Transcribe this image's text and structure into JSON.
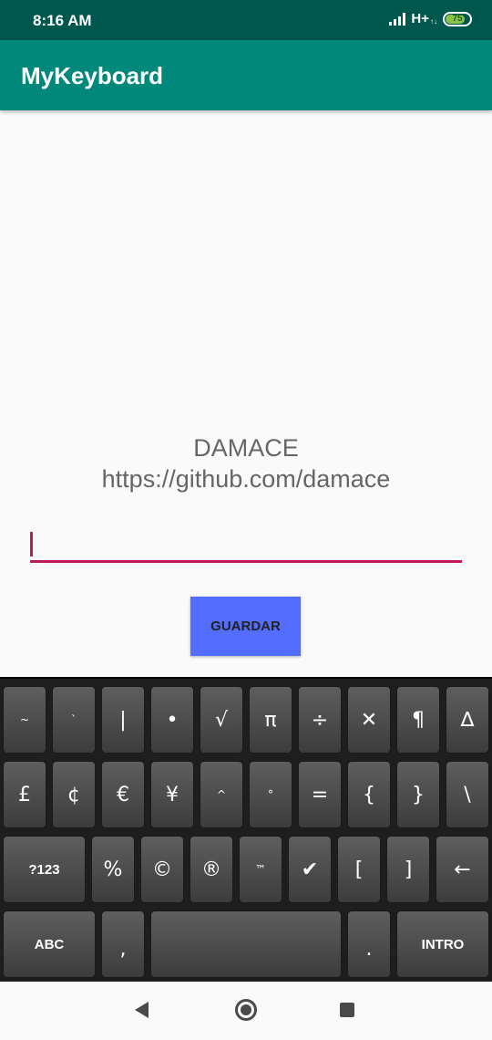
{
  "status": {
    "time": "8:16 AM",
    "network": "H+",
    "network_sub": "↑↓",
    "battery": "75"
  },
  "app": {
    "title": "MyKeyboard"
  },
  "main": {
    "info_name": "DAMACE",
    "info_url": "https://github.com/damace",
    "input_value": "",
    "save_label": "GUARDAR"
  },
  "keyboard": {
    "row1": [
      "~",
      "`",
      "|",
      "•",
      "√",
      "π",
      "÷",
      "✕",
      "¶",
      "∆"
    ],
    "row2": [
      "£",
      "¢",
      "€",
      "¥",
      "^",
      "°",
      "=",
      "{",
      "}",
      "\\"
    ],
    "row3": [
      "?123",
      "%",
      "©",
      "®",
      "™",
      "✔",
      "[",
      "]",
      "←"
    ],
    "row4": [
      "ABC",
      ",",
      "",
      ".",
      "INTRO"
    ]
  },
  "nav": {
    "back": "back-icon",
    "home": "home-icon",
    "recent": "recent-apps-icon"
  },
  "colors": {
    "status_bar": "#00574d",
    "app_bar": "#00897b",
    "accent": "#c2185b",
    "button": "#536dfe"
  }
}
